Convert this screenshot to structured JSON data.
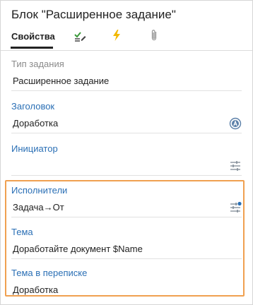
{
  "panel": {
    "title": "Блок \"Расширенное задание\""
  },
  "tabs": [
    {
      "label": "Свойства",
      "icon": "properties-tab"
    },
    {
      "label": "",
      "icon": "checklist-edit-icon"
    },
    {
      "label": "",
      "icon": "lightning-icon"
    },
    {
      "label": "",
      "icon": "paperclip-icon"
    }
  ],
  "fields": {
    "task_type": {
      "label": "Тип задания",
      "value": "Расширенное задание"
    },
    "header": {
      "label": "Заголовок",
      "value": "Доработка",
      "icon": "template-a-icon"
    },
    "initiator": {
      "label": "Инициатор",
      "value": "",
      "icon": "sliders-icon"
    },
    "performers": {
      "label": "Исполнители",
      "value": "Задача→От",
      "icon": "sliders-active-icon"
    },
    "subject": {
      "label": "Тема",
      "value": "Доработайте документ $Name"
    },
    "correspondence_subject": {
      "label": "Тема в переписке",
      "value": "Доработка"
    }
  },
  "colors": {
    "accent_label": "#2a6fb5",
    "highlight_border": "#f0a050",
    "lightning": "#f2b800",
    "check_green": "#3a9a3a"
  }
}
